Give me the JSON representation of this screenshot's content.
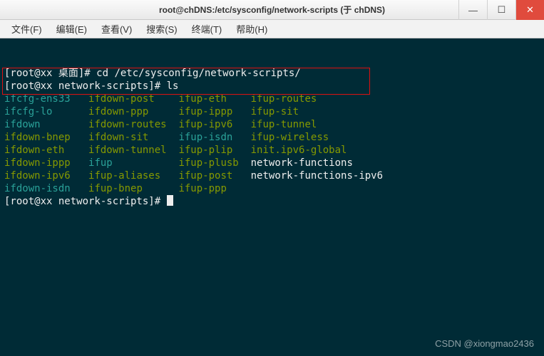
{
  "titlebar": {
    "title": "root@chDNS:/etc/sysconfig/network-scripts (于 chDNS)"
  },
  "win": {
    "min": "—",
    "max": "☐",
    "close": "✕"
  },
  "menu": {
    "file": "文件(F)",
    "edit": "编辑(E)",
    "view": "查看(V)",
    "search": "搜索(S)",
    "terminal": "终端(T)",
    "help": "帮助(H)"
  },
  "term": {
    "prompt1_pre": "[root@xx 桌面]# ",
    "cmd1": "cd /etc/sysconfig/network-scripts/",
    "prompt2_pre": "[root@xx network-scripts]# ",
    "cmd2": "ls",
    "rows": [
      [
        {
          "t": "ifcfg-ens33",
          "c": "cyan",
          "w": 14
        },
        {
          "t": "ifdown-post",
          "c": "green",
          "w": 15
        },
        {
          "t": "ifup-eth",
          "c": "green",
          "w": 12
        },
        {
          "t": "ifup-routes",
          "c": "green",
          "w": 0
        }
      ],
      [
        {
          "t": "ifcfg-lo",
          "c": "cyan",
          "w": 14
        },
        {
          "t": "ifdown-ppp",
          "c": "green",
          "w": 15
        },
        {
          "t": "ifup-ippp",
          "c": "green",
          "w": 12
        },
        {
          "t": "ifup-sit",
          "c": "green",
          "w": 0
        }
      ],
      [
        {
          "t": "ifdown",
          "c": "cyan",
          "w": 14
        },
        {
          "t": "ifdown-routes",
          "c": "green",
          "w": 15
        },
        {
          "t": "ifup-ipv6",
          "c": "green",
          "w": 12
        },
        {
          "t": "ifup-tunnel",
          "c": "green",
          "w": 0
        }
      ],
      [
        {
          "t": "ifdown-bnep",
          "c": "green",
          "w": 14
        },
        {
          "t": "ifdown-sit",
          "c": "green",
          "w": 15
        },
        {
          "t": "ifup-isdn",
          "c": "cyan",
          "w": 12
        },
        {
          "t": "ifup-wireless",
          "c": "green",
          "w": 0
        }
      ],
      [
        {
          "t": "ifdown-eth",
          "c": "green",
          "w": 14
        },
        {
          "t": "ifdown-tunnel",
          "c": "green",
          "w": 15
        },
        {
          "t": "ifup-plip",
          "c": "green",
          "w": 12
        },
        {
          "t": "init.ipv6-global",
          "c": "green",
          "w": 0
        }
      ],
      [
        {
          "t": "ifdown-ippp",
          "c": "green",
          "w": 14
        },
        {
          "t": "ifup",
          "c": "cyan",
          "w": 15
        },
        {
          "t": "ifup-plusb",
          "c": "green",
          "w": 12
        },
        {
          "t": "network-functions",
          "c": "white",
          "w": 0
        }
      ],
      [
        {
          "t": "ifdown-ipv6",
          "c": "green",
          "w": 14
        },
        {
          "t": "ifup-aliases",
          "c": "green",
          "w": 15
        },
        {
          "t": "ifup-post",
          "c": "green",
          "w": 12
        },
        {
          "t": "network-functions-ipv6",
          "c": "white",
          "w": 0
        }
      ],
      [
        {
          "t": "ifdown-isdn",
          "c": "cyan",
          "w": 14
        },
        {
          "t": "ifup-bnep",
          "c": "green",
          "w": 15
        },
        {
          "t": "ifup-ppp",
          "c": "green",
          "w": 12
        }
      ]
    ],
    "prompt3_pre": "[root@xx network-scripts]# "
  },
  "watermark": "CSDN @xiongmao2436"
}
